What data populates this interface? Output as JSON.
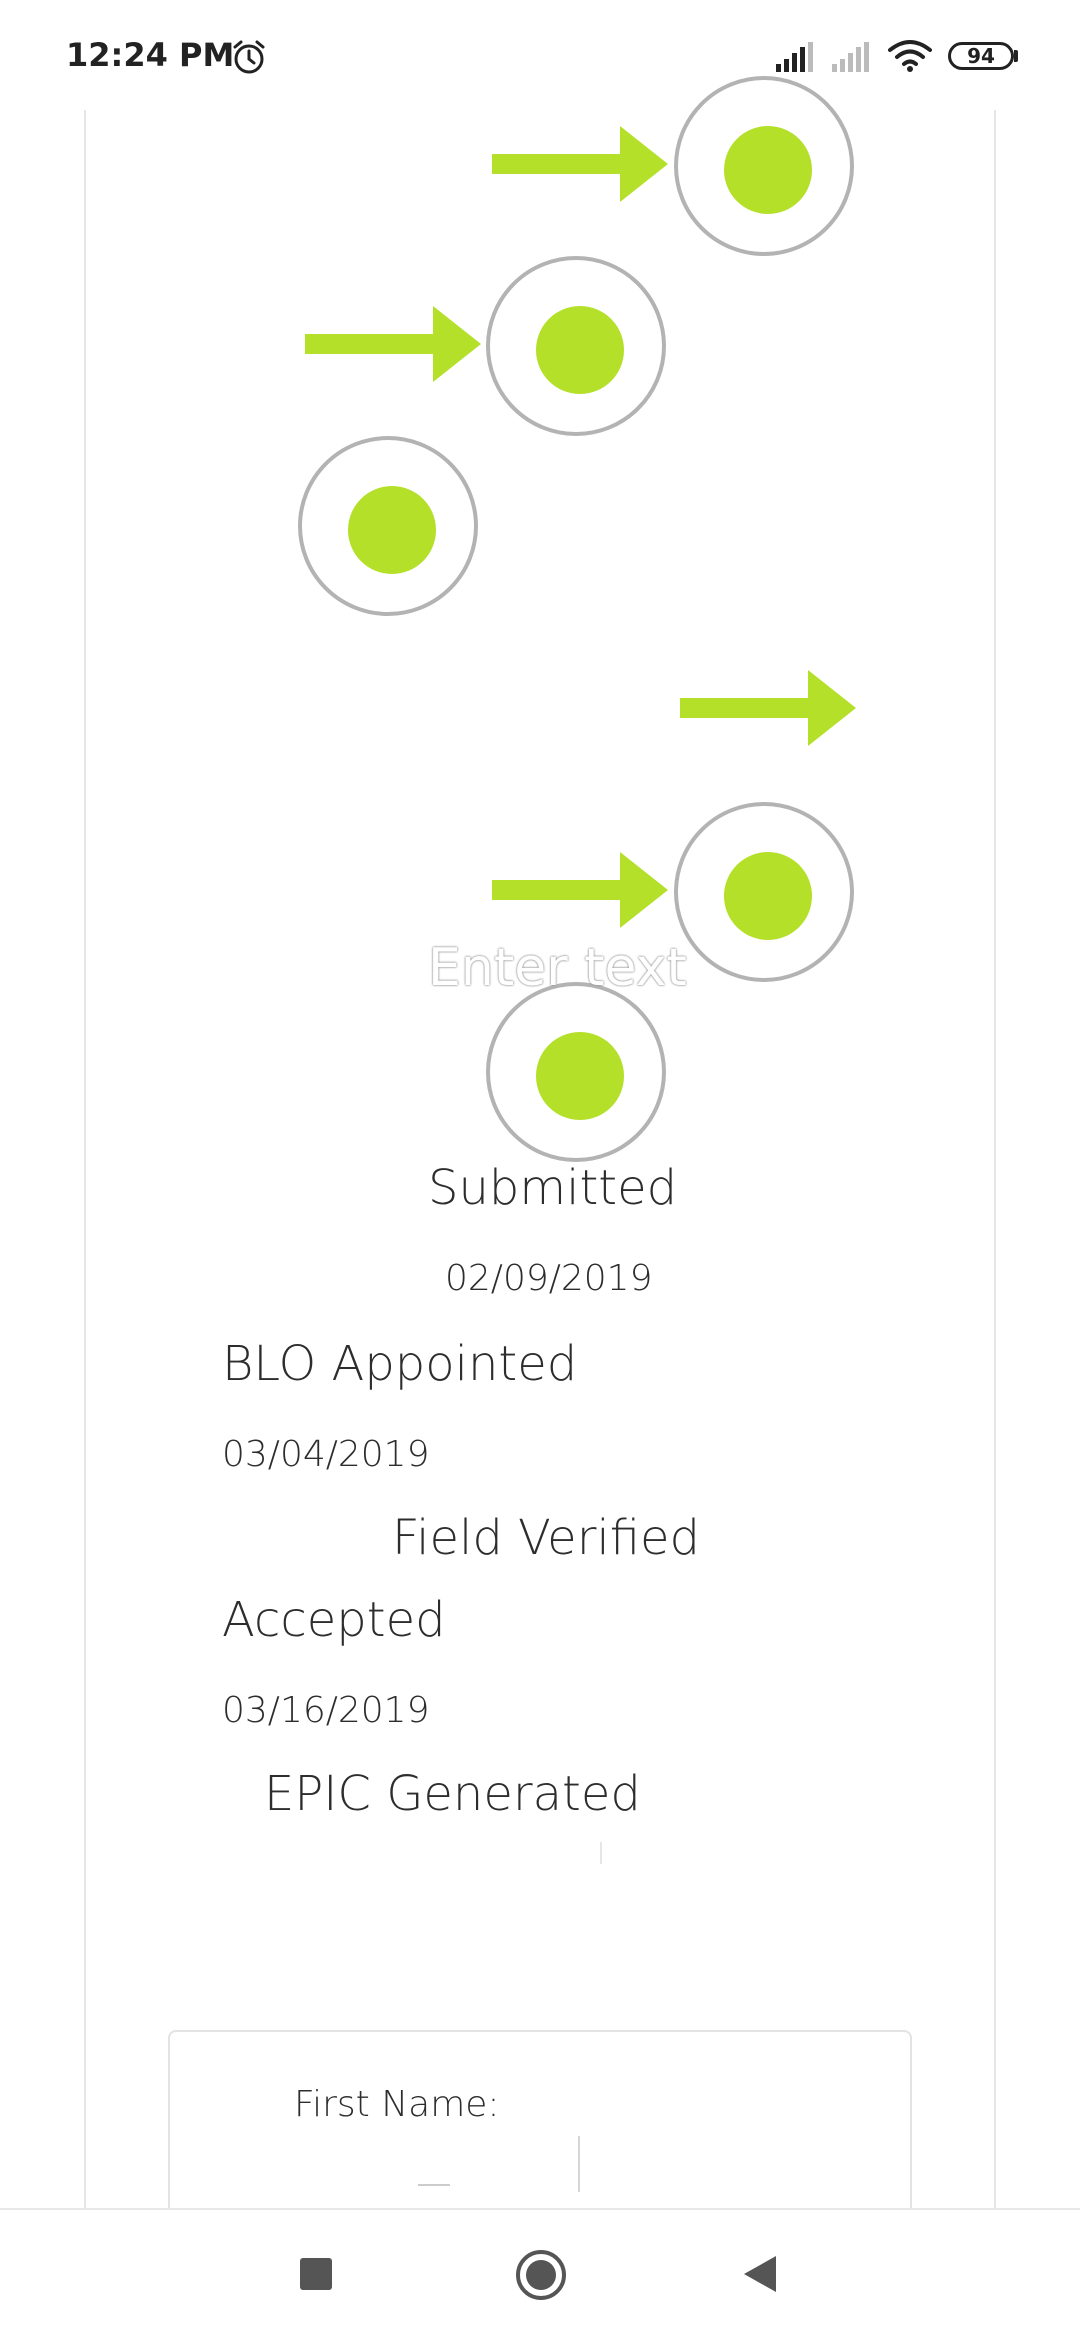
{
  "status_bar": {
    "time": "12:24 PM",
    "battery_level": "94",
    "icons": [
      "alarm-icon",
      "signal-icon",
      "signal-weak-icon",
      "wifi-icon",
      "battery-icon"
    ]
  },
  "timeline": {
    "overlay_placeholder": "Enter text",
    "steps": [
      {
        "label": "Submitted",
        "date": "02/09/2019"
      },
      {
        "label": "BLO Appointed",
        "date": "03/04/2019"
      },
      {
        "label": "Field Verified"
      },
      {
        "label": "Accepted",
        "date": "03/16/2019"
      },
      {
        "label": "EPIC Generated"
      }
    ]
  },
  "form": {
    "first_name_label": "First Name:"
  },
  "nav_bar": {
    "icons": [
      "recents-icon",
      "home-icon",
      "back-icon"
    ]
  },
  "colors": {
    "accent_green": "#b4e02a",
    "ring_gray": "#b3b3b3",
    "text": "#2d2d2d"
  }
}
